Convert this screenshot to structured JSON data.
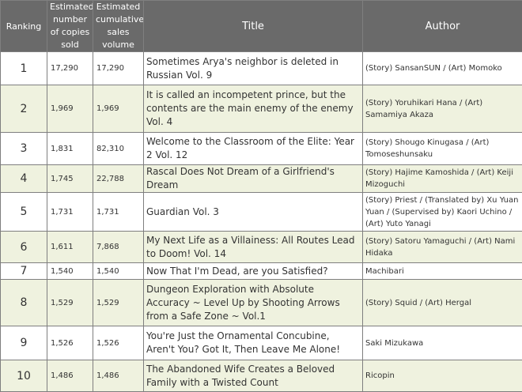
{
  "headers": {
    "ranking": "Ranking",
    "copies": "Estimated number of copies sold",
    "cumulative": "Estimated cumulative sales volume",
    "title": "Title",
    "author": "Author"
  },
  "rows": [
    {
      "rank": "1",
      "copies": "17,290",
      "cumulative": "17,290",
      "title": "Sometimes Arya's neighbor is deleted in Russian Vol. 9",
      "author": "(Story) SansanSUN / (Art) Momoko"
    },
    {
      "rank": "2",
      "copies": "1,969",
      "cumulative": "1,969",
      "title": "It is called an incompetent prince, but the contents are the main enemy of the enemy Vol. 4",
      "author": "(Story) Yoruhikari Hana / (Art) Samamiya Akaza"
    },
    {
      "rank": "3",
      "copies": "1,831",
      "cumulative": "82,310",
      "title": "Welcome to the Classroom of the Elite: Year 2 Vol. 12",
      "author": "(Story) Shougo Kinugasa / (Art) Tomoseshunsaku"
    },
    {
      "rank": "4",
      "copies": "1,745",
      "cumulative": "22,788",
      "title": "Rascal Does Not Dream of a Girlfriend's Dream",
      "author": "(Story) Hajime Kamoshida / (Art) Keiji Mizoguchi"
    },
    {
      "rank": "5",
      "copies": "1,731",
      "cumulative": "1,731",
      "title": "Guardian Vol. 3",
      "author": "(Story) Priest / (Translated by) Xu Yuan Yuan / (Supervised by) Kaori Uchino / (Art) Yuto Yanagi"
    },
    {
      "rank": "6",
      "copies": "1,611",
      "cumulative": "7,868",
      "title": "My Next Life as a Villainess: All Routes Lead to Doom! Vol. 14",
      "author": "(Story) Satoru Yamaguchi / (Art) Nami Hidaka"
    },
    {
      "rank": "7",
      "copies": "1,540",
      "cumulative": "1,540",
      "title": "Now That I'm Dead, are you Satisfied?",
      "author": "Machibari"
    },
    {
      "rank": "8",
      "copies": "1,529",
      "cumulative": "1,529",
      "title": "Dungeon Exploration with Absolute Accuracy ~ Level Up by Shooting Arrows from a Safe Zone ~ Vol.1",
      "author": "(Story) Squid / (Art) Hergal"
    },
    {
      "rank": "9",
      "copies": "1,526",
      "cumulative": "1,526",
      "title": "You're Just the Ornamental Concubine, Aren't You? Got It, Then Leave Me Alone!",
      "author": "Saki Mizukawa"
    },
    {
      "rank": "10",
      "copies": "1,486",
      "cumulative": "1,486",
      "title": "The Abandoned Wife Creates a Beloved Family with a Twisted Count",
      "author": "Ricopin"
    }
  ]
}
